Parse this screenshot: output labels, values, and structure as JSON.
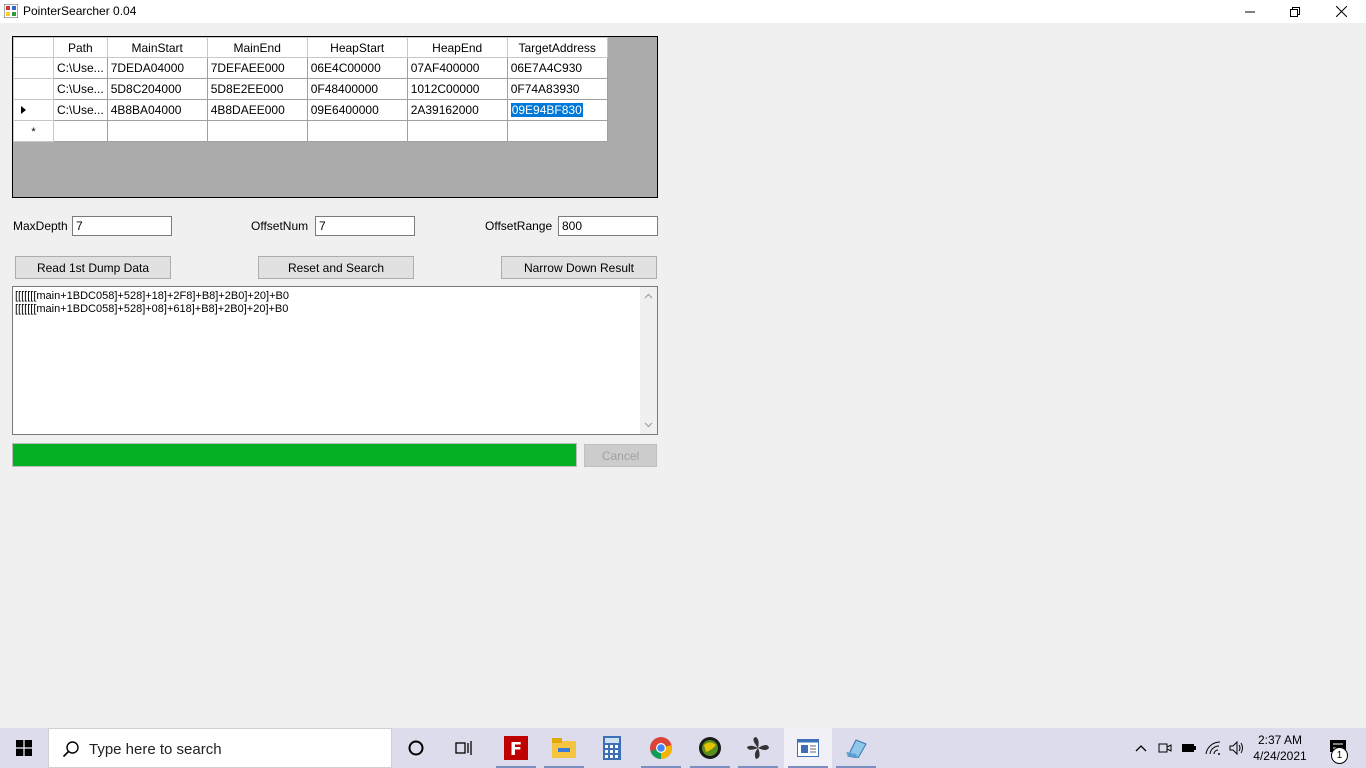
{
  "window": {
    "title": "PointerSearcher 0.04"
  },
  "grid": {
    "columns": [
      "Path",
      "MainStart",
      "MainEnd",
      "HeapStart",
      "HeapEnd",
      "TargetAddress"
    ],
    "rows": [
      [
        "C:\\Use...",
        "7DEDA04000",
        "7DEFAEE000",
        "06E4C00000",
        "07AF400000",
        "06E7A4C930"
      ],
      [
        "C:\\Use...",
        "5D8C204000",
        "5D8E2EE000",
        "0F48400000",
        "1012C00000",
        "0F74A83930"
      ],
      [
        "C:\\Use...",
        "4B8BA04000",
        "4B8DAEE000",
        "09E6400000",
        "2A39162000",
        "09E94BF830"
      ]
    ],
    "new_row_marker": "*"
  },
  "fields": {
    "max_depth": {
      "label": "MaxDepth",
      "value": "7"
    },
    "offset_num": {
      "label": "OffsetNum",
      "value": "7"
    },
    "offset_range": {
      "label": "OffsetRange",
      "value": "800"
    }
  },
  "buttons": {
    "read_dump": "Read 1st Dump Data",
    "reset_search": "Reset and Search",
    "narrow_down": "Narrow Down Result",
    "cancel": "Cancel"
  },
  "output": {
    "lines": [
      "[[[[[[[main+1BDC058]+528]+18]+2F8]+B8]+2B0]+20]+B0",
      "[[[[[[[main+1BDC058]+528]+08]+618]+B8]+2B0]+20]+B0"
    ]
  },
  "progress": {
    "fraction": 1.0,
    "color": "#06b025"
  },
  "taskbar": {
    "search_placeholder": "Type here to search",
    "time": "2:37 AM",
    "date": "4/24/2021",
    "notification_count": "1"
  },
  "colors": {
    "selection": "#0078d7",
    "accent": "#06b025"
  }
}
